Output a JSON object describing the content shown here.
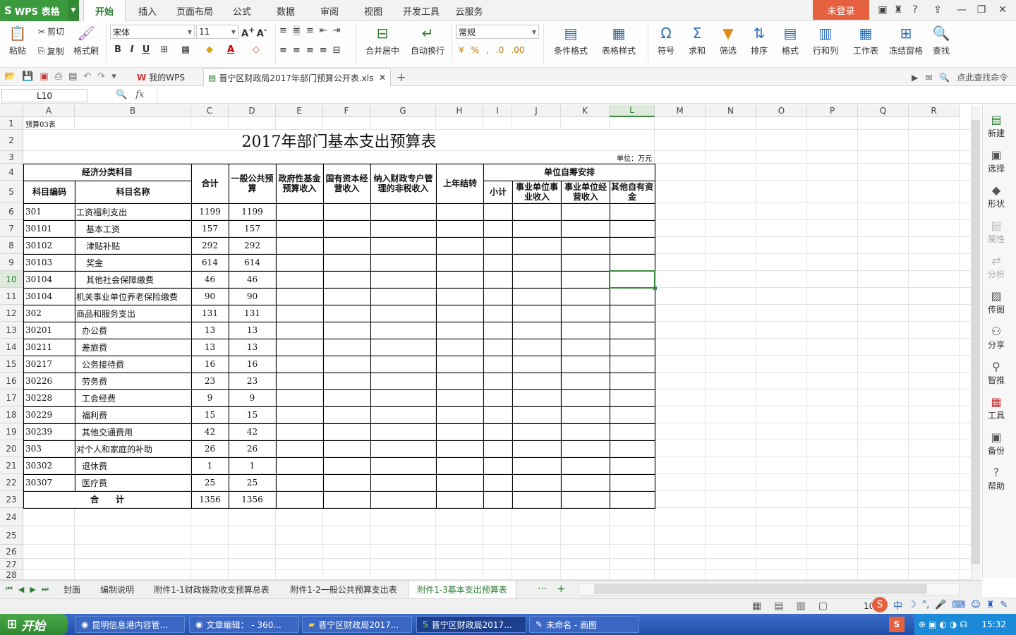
{
  "titlebar": {
    "app": "WPS 表格",
    "tabs": [
      "开始",
      "插入",
      "页面布局",
      "公式",
      "数据",
      "审阅",
      "视图",
      "开发工具",
      "云服务"
    ],
    "login": "未登录"
  },
  "ribbon": {
    "paste": "粘贴",
    "cut": "剪切",
    "copy": "复制",
    "format_painter": "格式刷",
    "font": "宋体",
    "size": "11",
    "merge": "合并居中",
    "wrap": "自动换行",
    "numfmt": "常规",
    "cond_format": "条件格式",
    "table_style": "表格样式",
    "symbol": "符号",
    "sum": "求和",
    "filter": "筛选",
    "sort": "排序",
    "format": "格式",
    "rowcol": "行和列",
    "sheet": "工作表",
    "freeze": "冻结窗格",
    "find": "查找",
    "find_cmd": "点此查找命令"
  },
  "docs": {
    "mywps": "我的WPS",
    "file": "晋宁区财政局2017年部门预算公开表.xls"
  },
  "formula": {
    "namebox": "L10",
    "fx": "fx"
  },
  "columns": [
    "A",
    "B",
    "C",
    "D",
    "E",
    "F",
    "G",
    "H",
    "I",
    "J",
    "K",
    "L",
    "M",
    "N",
    "O",
    "P",
    "Q",
    "R"
  ],
  "sheet": {
    "r1": "预算03表",
    "title": "2017年部门基本支出预算表",
    "unit": "单位：万元",
    "h_econ": "经济分类科目",
    "h_code": "科目编码",
    "h_name": "科目名称",
    "h_total": "合计",
    "h_general": "一般公共预算",
    "h_gov": "政府性基金预算收入",
    "h_state": "国有资本经营收入",
    "h_fiscal": "纳入财政专户管理的非税收入",
    "h_carry": "上年结转",
    "h_self": "单位自筹安排",
    "h_sub": "小计",
    "h_biz_in": "事业单位事业收入",
    "h_biz_op": "事业单位经营收入",
    "h_other": "其他自有资金",
    "rows": [
      {
        "code": "301",
        "name": "工资福利支出",
        "total": "1199",
        "gen": "1199"
      },
      {
        "code": "30101",
        "name": "基本工资",
        "total": "157",
        "gen": "157"
      },
      {
        "code": "30102",
        "name": "津贴补贴",
        "total": "292",
        "gen": "292"
      },
      {
        "code": "30103",
        "name": "奖金",
        "total": "614",
        "gen": "614"
      },
      {
        "code": "30104",
        "name": "其他社会保障缴费",
        "total": "46",
        "gen": "46"
      },
      {
        "code": "30104",
        "name": "机关事业单位养老保险缴费",
        "total": "90",
        "gen": "90"
      },
      {
        "code": "302",
        "name": "商品和服务支出",
        "total": "131",
        "gen": "131"
      },
      {
        "code": "30201",
        "name": "办公费",
        "total": "13",
        "gen": "13"
      },
      {
        "code": "30211",
        "name": "差旅费",
        "total": "13",
        "gen": "13"
      },
      {
        "code": "30217",
        "name": "公务接待费",
        "total": "16",
        "gen": "16"
      },
      {
        "code": "30226",
        "name": "劳务费",
        "total": "23",
        "gen": "23"
      },
      {
        "code": "30228",
        "name": "工会经费",
        "total": "9",
        "gen": "9"
      },
      {
        "code": "30229",
        "name": "福利费",
        "total": "15",
        "gen": "15"
      },
      {
        "code": "30239",
        "name": "其他交通费用",
        "total": "42",
        "gen": "42"
      },
      {
        "code": "303",
        "name": "对个人和家庭的补助",
        "total": "26",
        "gen": "26"
      },
      {
        "code": "30302",
        "name": "退休费",
        "total": "1",
        "gen": "1"
      },
      {
        "code": "30307",
        "name": "医疗费",
        "total": "25",
        "gen": "25"
      }
    ],
    "sum_label": "合　　计",
    "sum_total": "1356",
    "sum_gen": "1356"
  },
  "right_panel": [
    "新建",
    "选择",
    "形状",
    "属性",
    "分析",
    "传图",
    "分享",
    "智推",
    "工具",
    "备份",
    "帮助"
  ],
  "sheet_tabs": [
    "封面",
    "编制说明",
    "附件1-1财政拨款收支预算总表",
    "附件1-2一般公共预算支出表",
    "附件1-3基本支出预算表"
  ],
  "taskbar": {
    "start": "开始",
    "items": [
      "昆明信息港内容管...",
      "文章编辑： - 360...",
      "晋宁区财政局2017...",
      "晋宁区财政局2017...",
      "未命名 - 画图"
    ],
    "time": "15:32",
    "zoom": "10"
  }
}
